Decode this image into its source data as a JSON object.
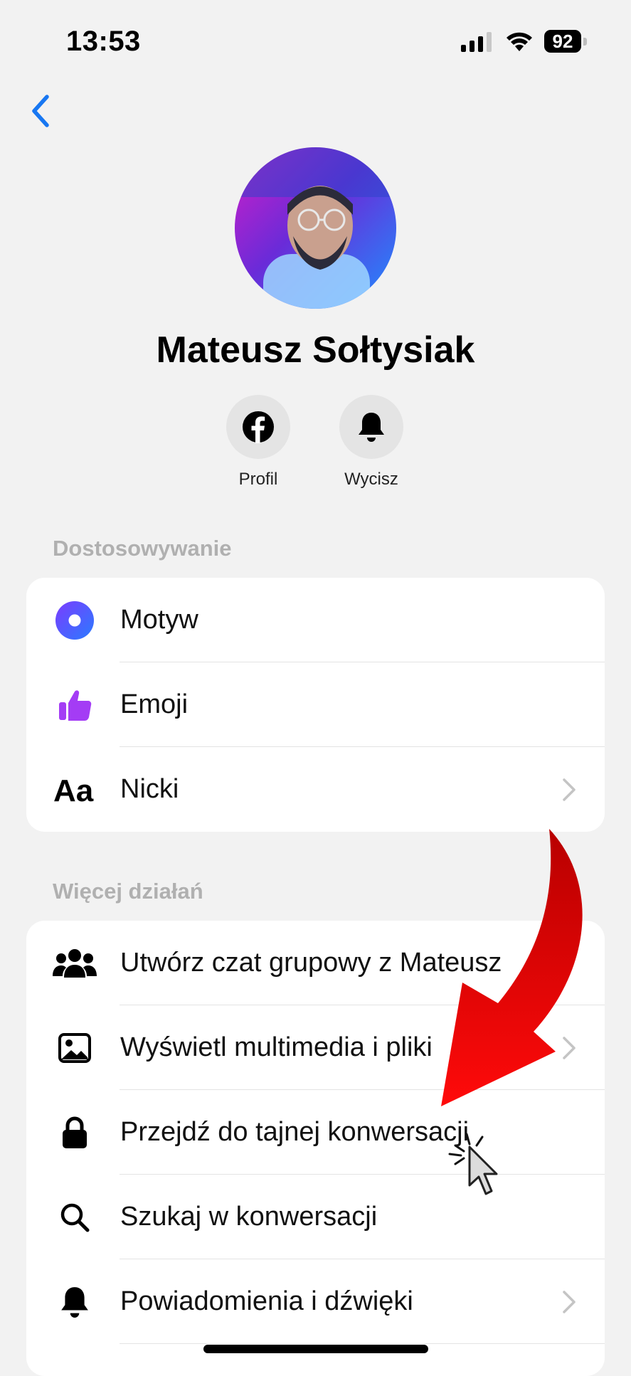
{
  "status": {
    "time": "13:53",
    "battery": "92"
  },
  "profile": {
    "name": "Mateusz Sołtysiak"
  },
  "actions": [
    {
      "label": "Profil",
      "icon": "facebook-icon"
    },
    {
      "label": "Wycisz",
      "icon": "bell-icon"
    }
  ],
  "sections": [
    {
      "title": "Dostosowywanie",
      "items": [
        {
          "label": "Motyw",
          "icon": "theme-circle-icon"
        },
        {
          "label": "Emoji",
          "icon": "thumbs-up-icon"
        },
        {
          "label": "Nicki",
          "icon": "font-aa-icon"
        }
      ]
    },
    {
      "title": "Więcej działań",
      "items": [
        {
          "label": "Utwórz czat grupowy z Mateusz",
          "icon": "group-icon"
        },
        {
          "label": "Wyświetl multimedia i pliki",
          "icon": "image-icon"
        },
        {
          "label": "Przejdź do tajnej konwersacji",
          "icon": "lock-icon"
        },
        {
          "label": "Szukaj w konwersacji",
          "icon": "search-icon"
        },
        {
          "label": "Powiadomienia i dźwięki",
          "icon": "bell-icon"
        }
      ]
    }
  ],
  "colors": {
    "accent": "#1877f2",
    "theme_gradient": [
      "#5b4bff",
      "#2a7bff"
    ],
    "emoji": "#a43cf5",
    "annotation_arrow": "#e10000"
  }
}
